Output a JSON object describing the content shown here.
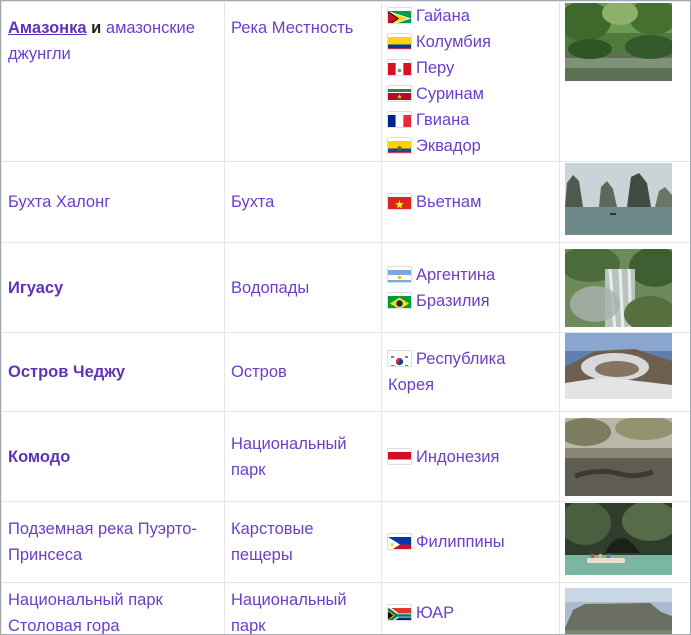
{
  "rows": [
    {
      "name": "Амазонка",
      "name_suffix": "и",
      "name_extra": "амазонские джунгли",
      "type": "Река Местность",
      "countries": [
        "Гайана",
        "Колумбия",
        "Перу",
        "Суринам",
        "Гвиана",
        "Эквадор"
      ]
    },
    {
      "name": "Бухта Халонг",
      "type": "Бухта",
      "countries": [
        "Вьетнам"
      ]
    },
    {
      "name": "Игуасу",
      "type": "Водопады",
      "countries": [
        "Аргентина",
        "Бразилия"
      ]
    },
    {
      "name": "Остров Чеджу",
      "type": "Остров",
      "countries": [
        "Республика Корея"
      ]
    },
    {
      "name": "Комодо",
      "type": "Национальный парк",
      "countries": [
        "Индонезия"
      ]
    },
    {
      "name": "Подземная река Пуэрто-Принсеса",
      "type": "Карстовые пещеры",
      "countries": [
        "Филиппины"
      ]
    },
    {
      "name": "Национальный парк Столовая гора",
      "type": "Национальный парк",
      "countries": [
        "ЮАР"
      ]
    }
  ],
  "icons": {
    "flags": [
      "guyana-flag-icon",
      "colombia-flag-icon",
      "peru-flag-icon",
      "suriname-flag-icon",
      "france-flag-icon",
      "ecuador-flag-icon",
      "vietnam-flag-icon",
      "argentina-flag-icon",
      "brazil-flag-icon",
      "south-korea-flag-icon",
      "indonesia-flag-icon",
      "philippines-flag-icon",
      "south-africa-flag-icon"
    ]
  },
  "colors": {
    "link": "#6b3fc8",
    "link_bold": "#5f33b9",
    "border": "#e4e6ea",
    "frame": "#a2a9b1"
  }
}
